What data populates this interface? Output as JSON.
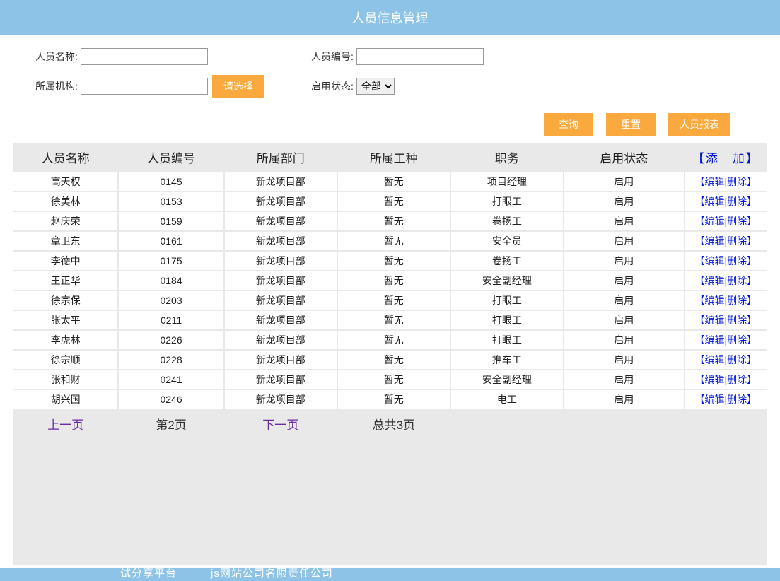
{
  "header": {
    "title": "人员信息管理"
  },
  "search": {
    "name_label": "人员名称:",
    "name_value": "",
    "code_label": "人员编号:",
    "code_value": "",
    "org_label": "所属机构:",
    "org_value": "",
    "choose_btn": "请选择",
    "status_label": "启用状态:",
    "status_selected": "全部"
  },
  "actions": {
    "query": "查询",
    "reset": "重置",
    "report": "人员报表"
  },
  "table": {
    "headers": {
      "name": "人员名称",
      "code": "人员编号",
      "dept": "所属部门",
      "work": "所属工种",
      "job": "职务",
      "status": "启用状态",
      "add": "【添　加】"
    },
    "edit_label": "编辑",
    "delete_label": "删除",
    "rows": [
      {
        "name": "高天权",
        "code": "0145",
        "dept": "新龙项目部",
        "work": "暂无",
        "job": "项目经理",
        "status": "启用"
      },
      {
        "name": "徐美林",
        "code": "0153",
        "dept": "新龙项目部",
        "work": "暂无",
        "job": "打眼工",
        "status": "启用"
      },
      {
        "name": "赵庆荣",
        "code": "0159",
        "dept": "新龙项目部",
        "work": "暂无",
        "job": "卷扬工",
        "status": "启用"
      },
      {
        "name": "章卫东",
        "code": "0161",
        "dept": "新龙项目部",
        "work": "暂无",
        "job": "安全员",
        "status": "启用"
      },
      {
        "name": "李德中",
        "code": "0175",
        "dept": "新龙项目部",
        "work": "暂无",
        "job": "卷扬工",
        "status": "启用"
      },
      {
        "name": "王正华",
        "code": "0184",
        "dept": "新龙项目部",
        "work": "暂无",
        "job": "安全副经理",
        "status": "启用"
      },
      {
        "name": "徐宗保",
        "code": "0203",
        "dept": "新龙项目部",
        "work": "暂无",
        "job": "打眼工",
        "status": "启用"
      },
      {
        "name": "张太平",
        "code": "0211",
        "dept": "新龙项目部",
        "work": "暂无",
        "job": "打眼工",
        "status": "启用"
      },
      {
        "name": "李虎林",
        "code": "0226",
        "dept": "新龙项目部",
        "work": "暂无",
        "job": "打眼工",
        "status": "启用"
      },
      {
        "name": "徐宗顺",
        "code": "0228",
        "dept": "新龙项目部",
        "work": "暂无",
        "job": "推车工",
        "status": "启用"
      },
      {
        "name": "张和财",
        "code": "0241",
        "dept": "新龙项目部",
        "work": "暂无",
        "job": "安全副经理",
        "status": "启用"
      },
      {
        "name": "胡兴国",
        "code": "0246",
        "dept": "新龙项目部",
        "work": "暂无",
        "job": "电工",
        "status": "启用"
      }
    ]
  },
  "pager": {
    "prev": "上一页",
    "current": "第2页",
    "next": "下一页",
    "total": "总共3页"
  },
  "footer": {
    "partial_text": "试分享平台　　　js网站公司名限责任公司"
  }
}
